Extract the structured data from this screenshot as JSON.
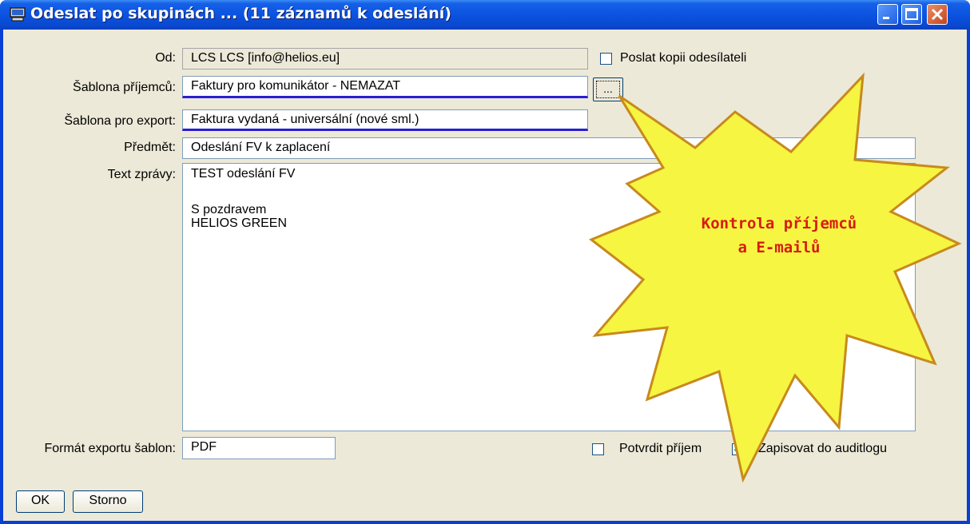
{
  "window": {
    "title": "Odeslat po skupinách ... (11 záznamů k odeslání)",
    "icon": "computer-icon",
    "controls": [
      "minimize-icon",
      "maximize-icon",
      "close-icon"
    ]
  },
  "form": {
    "from": {
      "label": "Od:",
      "value": "LCS LCS [info@helios.eu]"
    },
    "send_copy": {
      "label": "Poslat kopii odesílateli",
      "checked": false
    },
    "recipient_template": {
      "label": "Šablona příjemců:",
      "value": "Faktury pro komunikátor - NEMAZAT",
      "browse_label": "..."
    },
    "export_template": {
      "label": "Šablona pro export:",
      "value": "Faktura vydaná - universální (nové sml.)"
    },
    "subject": {
      "label": "Předmět:",
      "value": "Odeslání FV k zaplacení"
    },
    "message": {
      "label": "Text zprávy:",
      "lines": [
        "TEST odeslání FV",
        "",
        "S pozdravem",
        "HELIOS GREEN"
      ]
    },
    "export_format": {
      "label": "Formát exportu šablon:",
      "value": "PDF"
    },
    "confirm_receipt": {
      "label": "Potvrdit příjem",
      "checked": false
    },
    "audit_log": {
      "label": "Zapisovat do auditlogu",
      "checked": true
    }
  },
  "buttons": {
    "ok": "OK",
    "cancel": "Storno"
  },
  "callout": {
    "line1": "Kontrola příjemců",
    "line2": "a E-mailů"
  },
  "colors": {
    "title_bar": "#0a53e0",
    "dialog_bg": "#ece9d8",
    "callout_fill": "#f6f542",
    "callout_text": "#d81b12",
    "underline": "#2a1fd1"
  }
}
